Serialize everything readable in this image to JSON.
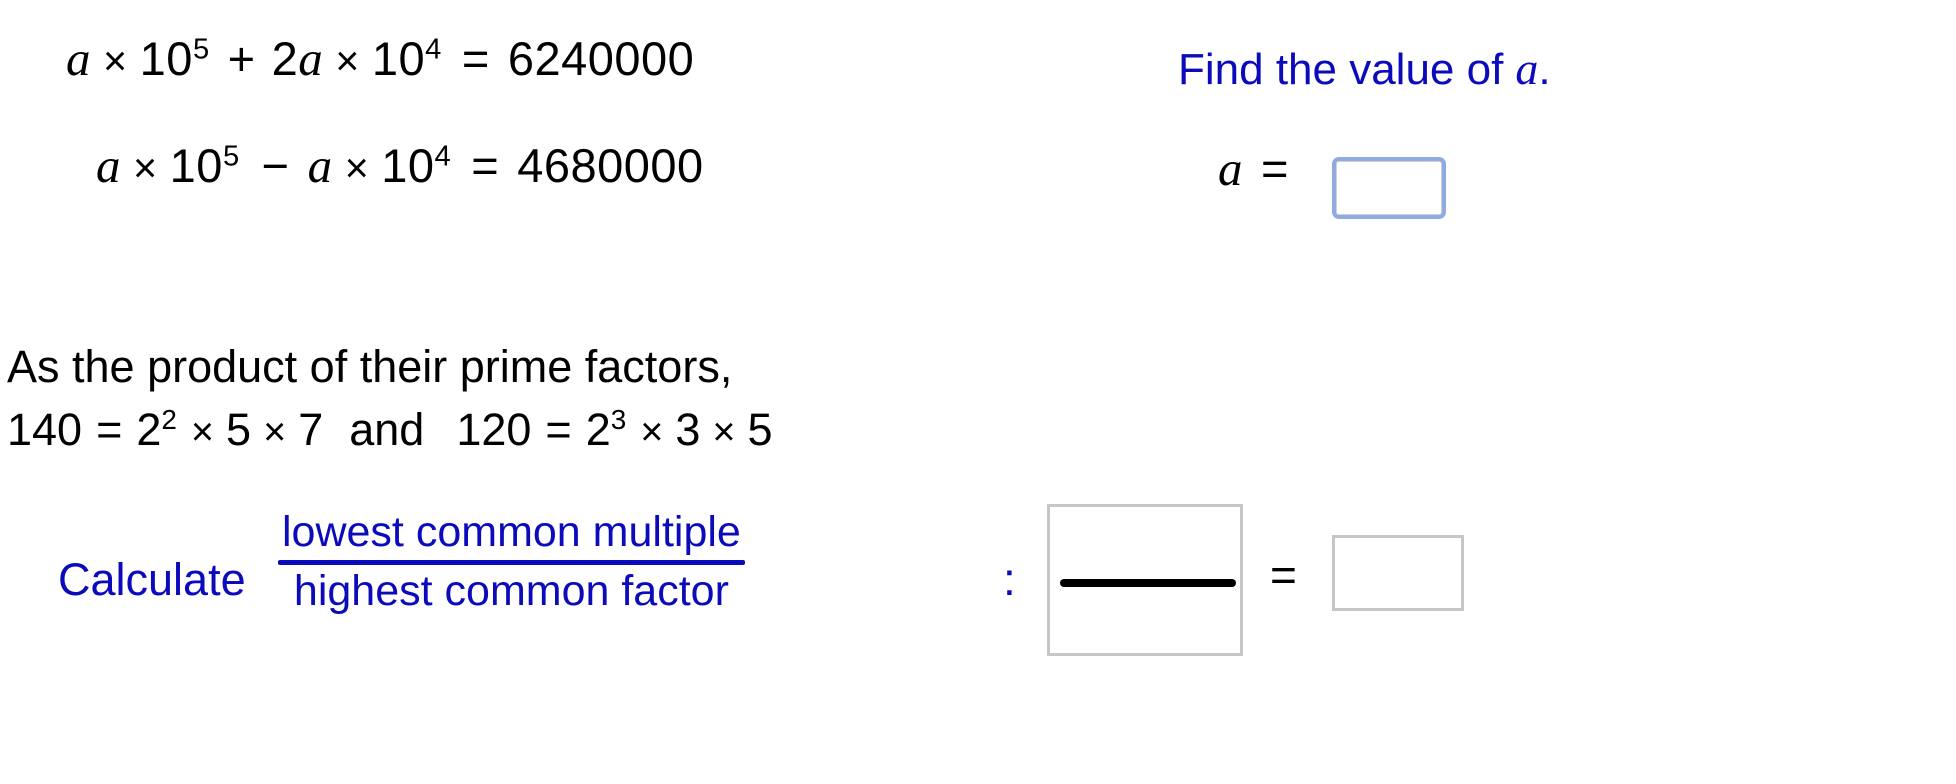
{
  "page": {
    "background": "#ffffff",
    "text_color": "#000000",
    "accent_color": "#0b0bbb",
    "focus_border_color": "#8fabe2",
    "box_border_color": "#c6c6c6"
  },
  "equations": {
    "line1": {
      "var1": "a",
      "times1": "×",
      "base1": "10",
      "exp1": "5",
      "plus": "+",
      "coef2": "2",
      "var2": "a",
      "times2": "×",
      "base2": "10",
      "exp2": "4",
      "equals": "=",
      "result": "6240000"
    },
    "line2": {
      "var1": "a",
      "times1": "×",
      "base1": "10",
      "exp1": "5",
      "minus": "−",
      "var2": "a",
      "times2": "×",
      "base2": "10",
      "exp2": "4",
      "equals": "=",
      "result": "4680000"
    }
  },
  "prompt": {
    "text_before": "Find the value of",
    "variable": "a",
    "period": ".",
    "answer_label_var": "a",
    "answer_label_equals": "=",
    "answer_value": "",
    "answer_placeholder": ""
  },
  "statement": {
    "line1": "As the product of their prime factors,",
    "line2": {
      "n1": "140",
      "eq1": "=",
      "base1": "2",
      "exp1": "2",
      "times1a": "×",
      "f1a": "5",
      "times1b": "×",
      "f1b": "7",
      "conjunction": "and",
      "n2": "120",
      "eq2": "=",
      "base2": "2",
      "exp2": "3",
      "times2a": "×",
      "f2a": "3",
      "times2b": "×",
      "f2b": "5"
    }
  },
  "calculate": {
    "label": "Calculate",
    "numerator": "lowest common multiple",
    "denominator": "highest common factor",
    "colon": ":",
    "equals": "=",
    "fraction_answer_numerator": "",
    "fraction_answer_denominator": "",
    "fraction_answer_placeholder": "",
    "result_value": "",
    "result_placeholder": ""
  }
}
